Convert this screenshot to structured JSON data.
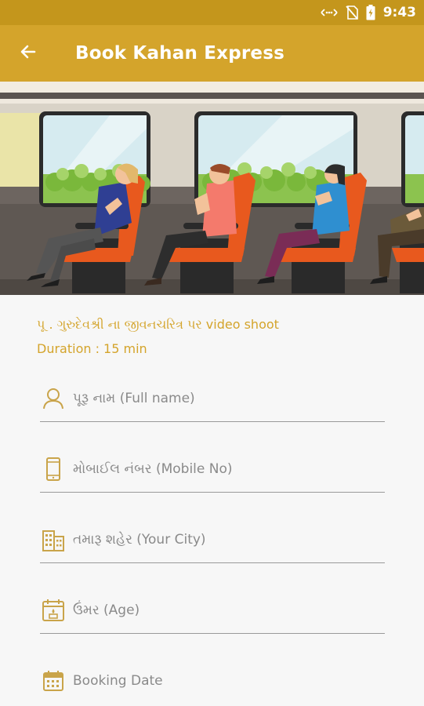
{
  "status_bar": {
    "time": "9:43",
    "icons": [
      "data-arrows-icon",
      "no-sim-icon",
      "battery-charging-icon"
    ]
  },
  "app_bar": {
    "back_icon": "arrow-left-icon",
    "title": "Book Kahan Express"
  },
  "banner": {
    "description_icon": "train-passengers-illustration"
  },
  "event": {
    "subtitle": "પૂ . ગુરુદેવશ્રી ના જીવનચરિત્ર પર video shoot",
    "duration": "Duration : 15 min"
  },
  "form": {
    "full_name": {
      "placeholder": "પૂરૂ નામ (Full name)",
      "icon": "person-icon"
    },
    "mobile": {
      "placeholder": "મોબાઈલ નંબર (Mobile No)",
      "icon": "mobile-phone-icon"
    },
    "city": {
      "placeholder": "તમારૂ શહેર (Your City)",
      "icon": "buildings-icon"
    },
    "age": {
      "placeholder": "ઉંમર (Age)",
      "icon": "calendar-cake-icon"
    },
    "booking_date": {
      "placeholder": "Booking Date",
      "icon": "calendar-icon"
    }
  },
  "colors": {
    "status_bar": "#c4961c",
    "app_bar": "#d4a42b",
    "accent_text": "#d4a42b",
    "background": "#f7f7f7"
  }
}
